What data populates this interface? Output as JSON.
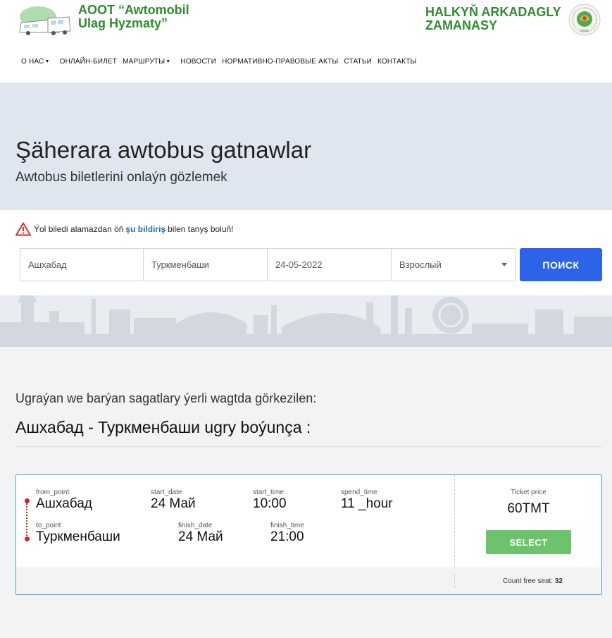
{
  "header": {
    "brand_line1": "AOOT “Awtomobil",
    "brand_line2": "Ulag Hyzmaty”",
    "right_line1": "HALKYŇ ARKADAGLY",
    "right_line2": "ZAMANASY"
  },
  "nav": {
    "items": [
      {
        "label": "О НАС",
        "dropdown": true
      },
      {
        "label": "ОНЛАЙН-БИЛЕТ",
        "dropdown": false
      },
      {
        "label": "МАРШРУТЫ",
        "dropdown": true
      },
      {
        "label": "НОВОСТИ",
        "dropdown": false
      },
      {
        "label": "НОРМАТИВНО-ПРАВОВЫЕ АКТЫ",
        "dropdown": false
      },
      {
        "label": "СТАТЬИ",
        "dropdown": false
      },
      {
        "label": "КОНТАКТЫ",
        "dropdown": false
      }
    ]
  },
  "hero": {
    "title": "Şäherara awtobus gatnawlar",
    "subtitle": "Awtobus biletlerini onlaýn gözlemek"
  },
  "notice": {
    "before": "Ýol biledi alamazdan öň",
    "link": "şu bildiriş",
    "after": "bilen tanyş boluň!"
  },
  "search": {
    "from_value": "Ашхабад",
    "to_value": "Туркменбаши",
    "date_value": "24-05-2022",
    "passenger_type": "Взрослый",
    "button_label": "ПОИСК"
  },
  "results": {
    "info": "Ugraýan we barýan sagatlary ýerli wagtda görkezilen:",
    "route_heading": "Ашхабад - Туркменбаши ugry boýunça :"
  },
  "trip": {
    "from_point_label": "from_point",
    "from_point": "Ашхабад",
    "start_date_label": "start_date",
    "start_date": "24 Май",
    "start_time_label": "start_time",
    "start_time": "10:00",
    "spend_time_label": "spend_time",
    "spend_time": "11 _hour",
    "to_point_label": "to_point",
    "to_point": "Туркменбаши",
    "finish_date_label": "finish_date",
    "finish_date": "24 Май",
    "finish_time_label": "finish_time",
    "finish_time": "21:00",
    "price_label": "Ticket price",
    "price": "60TMT",
    "select_label": "SELECT",
    "free_seat_label": "Count free seat:",
    "free_seat_count": "32"
  },
  "colors": {
    "brand_green": "#2e8b2e",
    "search_button": "#2d63e8",
    "select_button": "#6cc36c",
    "route_dot": "#c62828",
    "card_border": "#45a6cf"
  },
  "icons": {
    "logo": "bus-logo-icon",
    "emblem": "national-emblem-icon",
    "warning": "warning-triangle-icon",
    "dropdown": "caret-down-icon"
  }
}
